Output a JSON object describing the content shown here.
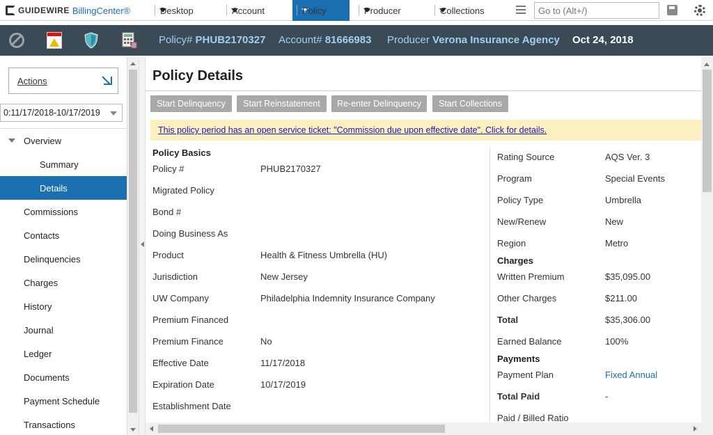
{
  "app": {
    "brand": "GUIDEWIRE",
    "product": "BillingCenter®"
  },
  "nav": {
    "tabs": [
      {
        "label": "Desktop"
      },
      {
        "label": "Account"
      },
      {
        "label": "Policy"
      },
      {
        "label": "Producer"
      },
      {
        "label": "Collections"
      }
    ],
    "goto_placeholder": "Go to (Alt+/)"
  },
  "infobar": {
    "policy_label": "Policy#",
    "policy_value": "PHUB2170327",
    "account_label": "Account#",
    "account_value": "81666983",
    "producer_label": "Producer",
    "producer_value": "Verona Insurance Agency",
    "date": "Oct 24, 2018"
  },
  "sidebar": {
    "actions_label": "Actions",
    "period": "0:11/17/2018-10/17/2019",
    "items": [
      {
        "label": "Overview"
      },
      {
        "label": "Summary"
      },
      {
        "label": "Details"
      },
      {
        "label": "Commissions"
      },
      {
        "label": "Contacts"
      },
      {
        "label": "Delinquencies"
      },
      {
        "label": "Charges"
      },
      {
        "label": "History"
      },
      {
        "label": "Journal"
      },
      {
        "label": "Ledger"
      },
      {
        "label": "Documents"
      },
      {
        "label": "Payment Schedule"
      },
      {
        "label": "Transactions"
      }
    ]
  },
  "main": {
    "title": "Policy Details",
    "buttons": [
      {
        "label": "Start Delinquency"
      },
      {
        "label": "Start Reinstatement"
      },
      {
        "label": "Re-enter Delinquency"
      },
      {
        "label": "Start Collections"
      }
    ],
    "banner": "This policy period has an open service ticket: \"Commission due upon effective date\". Click for details.",
    "left": {
      "section": "Policy Basics",
      "fields": [
        {
          "label": "Policy #",
          "value": "PHUB2170327"
        },
        {
          "label": "Migrated Policy",
          "value": ""
        },
        {
          "label": "Bond #",
          "value": ""
        },
        {
          "label": "Doing Business As",
          "value": ""
        },
        {
          "label": "Product",
          "value": "Health & Fitness Umbrella (HU)"
        },
        {
          "label": "Jurisdiction",
          "value": "New Jersey"
        },
        {
          "label": "UW Company",
          "value": "Philadelphia Indemnity Insurance Company"
        },
        {
          "label": "Premium Financed",
          "value": ""
        },
        {
          "label": "Premium Finance",
          "value": "No"
        },
        {
          "label": "Effective Date",
          "value": "11/17/2018"
        },
        {
          "label": "Expiration Date",
          "value": "10/17/2019"
        },
        {
          "label": "Establishment Date",
          "value": ""
        }
      ]
    },
    "right": {
      "fields_top": [
        {
          "label": "Rating Source",
          "value": "AQS Ver. 3"
        },
        {
          "label": "Program",
          "value": "Special Events"
        },
        {
          "label": "Policy Type",
          "value": "Umbrella"
        },
        {
          "label": "New/Renew",
          "value": "New"
        },
        {
          "label": "Region",
          "value": "Metro"
        }
      ],
      "charges_section": "Charges",
      "charges": [
        {
          "label": "Written Premium",
          "value": "$35,095.00"
        },
        {
          "label": "Other Charges",
          "value": "$211.00"
        },
        {
          "label": "Total",
          "value": "$35,306.00"
        },
        {
          "label": "Earned Balance",
          "value": "100%"
        }
      ],
      "payments_section": "Payments",
      "payments": [
        {
          "label": "Payment Plan",
          "value": "Fixed Annual"
        },
        {
          "label": "Total Paid",
          "value": "-"
        },
        {
          "label": "Paid / Billed Ratio",
          "value": ""
        }
      ]
    }
  }
}
